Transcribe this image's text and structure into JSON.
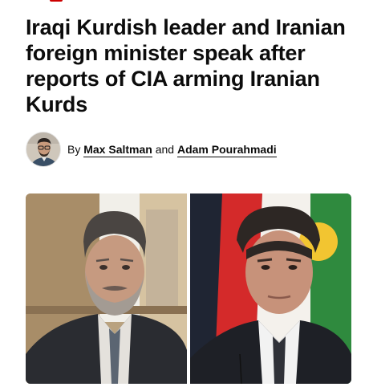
{
  "article": {
    "headline": "Iraqi Kurdish leader and Iranian foreign minister speak after reports of CIA arming Iranian Kurds",
    "byline": {
      "prefix": "By",
      "author_1": "Max Saltman",
      "conjunction": "and",
      "author_2": "Adam Pourahmadi"
    }
  },
  "icons": {
    "avatar": "author-avatar",
    "photo_left": "iranian-foreign-minister-photo",
    "photo_right": "iraqi-kurdish-leader-photo"
  },
  "colors": {
    "brand": "#cc0000",
    "text": "#0c0c0c",
    "background": "#ffffff"
  }
}
